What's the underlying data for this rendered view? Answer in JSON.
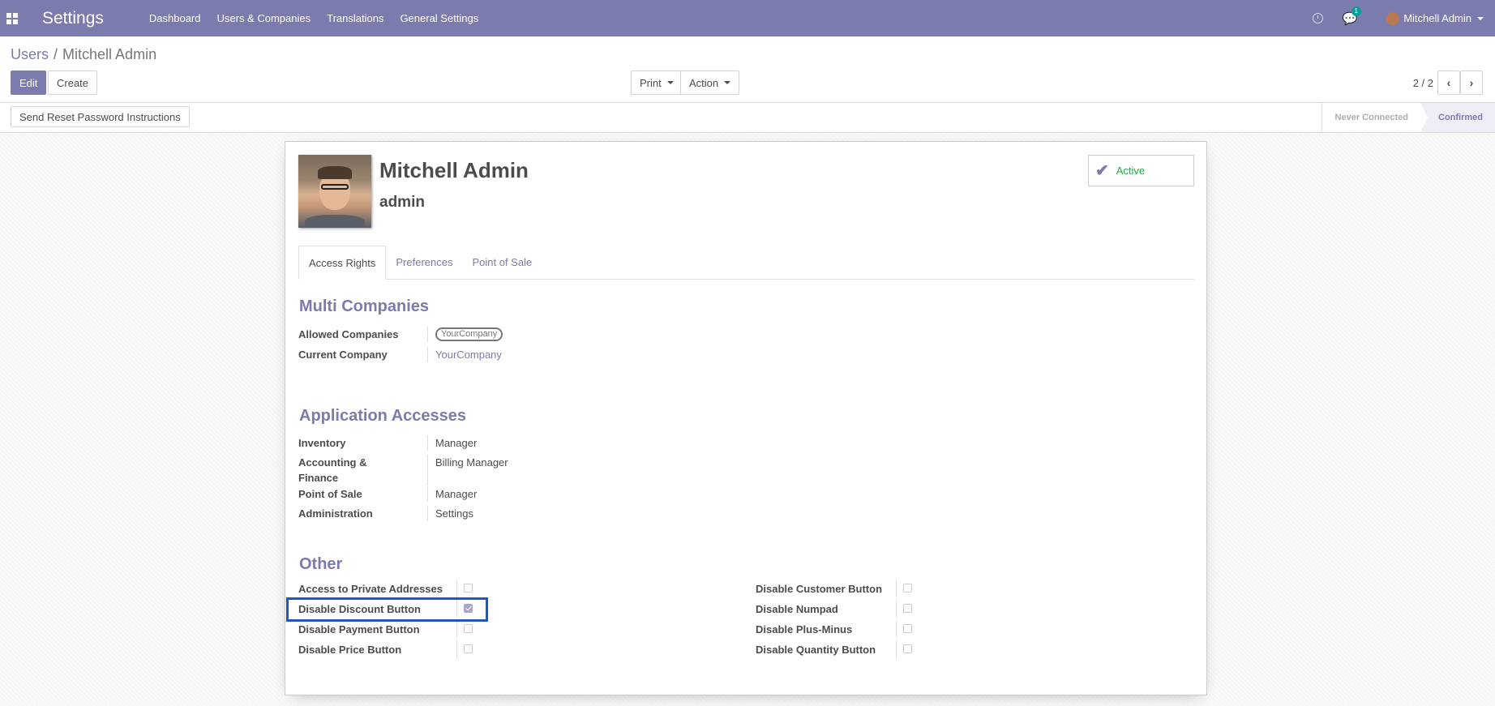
{
  "navbar": {
    "app_title": "Settings",
    "menu": [
      "Dashboard",
      "Users & Companies",
      "Translations",
      "General Settings"
    ],
    "chat_count": "1",
    "user_name": "Mitchell Admin",
    "color": "#7c7bad"
  },
  "breadcrumb": {
    "parent": "Users",
    "separator": "/",
    "current": "Mitchell Admin"
  },
  "buttons": {
    "edit": "Edit",
    "create": "Create",
    "print": "Print",
    "action": "Action",
    "reset_password": "Send Reset Password Instructions"
  },
  "pager": {
    "value": "2 / 2"
  },
  "status": {
    "steps": [
      "Never Connected",
      "Confirmed"
    ],
    "current": "Confirmed"
  },
  "user": {
    "name": "Mitchell Admin",
    "login": "admin",
    "active_label": "Active"
  },
  "tabs": [
    "Access Rights",
    "Preferences",
    "Point of Sale"
  ],
  "multi_companies": {
    "title": "Multi Companies",
    "allowed_label": "Allowed Companies",
    "allowed_value": "YourCompany",
    "current_label": "Current Company",
    "current_value": "YourCompany"
  },
  "app_access": {
    "title": "Application Accesses",
    "rows": [
      {
        "label": "Inventory",
        "value": "Manager"
      },
      {
        "label": "Accounting &",
        "label2": "Finance",
        "value": "Billing Manager"
      },
      {
        "label": "Point of Sale",
        "value": "Manager"
      },
      {
        "label": "Administration",
        "value": "Settings"
      }
    ]
  },
  "other": {
    "title": "Other",
    "left": [
      {
        "label": "Access to Private Addresses",
        "checked": false
      },
      {
        "label": "Disable Discount Button",
        "checked": true
      },
      {
        "label": "Disable Payment Button",
        "checked": false
      },
      {
        "label": "Disable Price Button",
        "checked": false
      }
    ],
    "right": [
      {
        "label": "Disable Customer Button",
        "checked": false
      },
      {
        "label": "Disable Numpad",
        "checked": false
      },
      {
        "label": "Disable Plus-Minus",
        "checked": false
      },
      {
        "label": "Disable Quantity Button",
        "checked": false
      }
    ]
  }
}
